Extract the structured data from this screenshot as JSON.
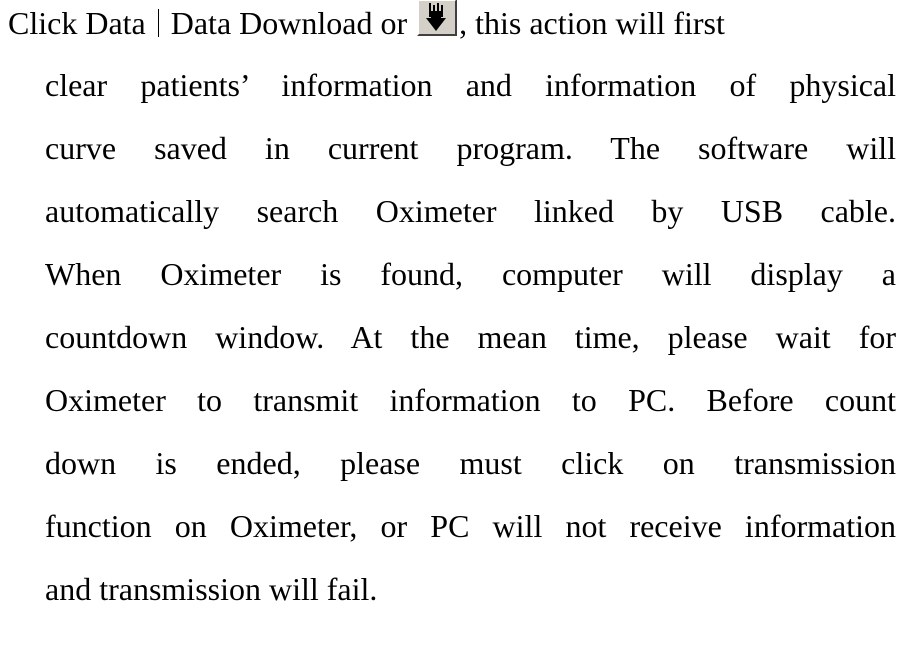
{
  "paragraph": {
    "first_line": {
      "menu_path_1": "Click Data",
      "menu_path_2": "Data Download or",
      "icon": "download-arrow-icon",
      "after_icon": ", this action will first"
    },
    "lines": [
      "clear patients’ information and information of physical",
      "curve saved in current program. The software will",
      "automatically search Oximeter linked by USB cable.",
      "When Oximeter is found, computer will display a",
      "countdown window. At the mean time, please wait for",
      "Oximeter to transmit information to PC. Before count",
      "down is ended, please must click on transmission",
      "function on Oximeter, or PC will not receive information",
      "and transmission will fail."
    ]
  },
  "colors": {
    "text": "#000000",
    "button_face": "#d4d0c8",
    "arrow": "#000000"
  }
}
